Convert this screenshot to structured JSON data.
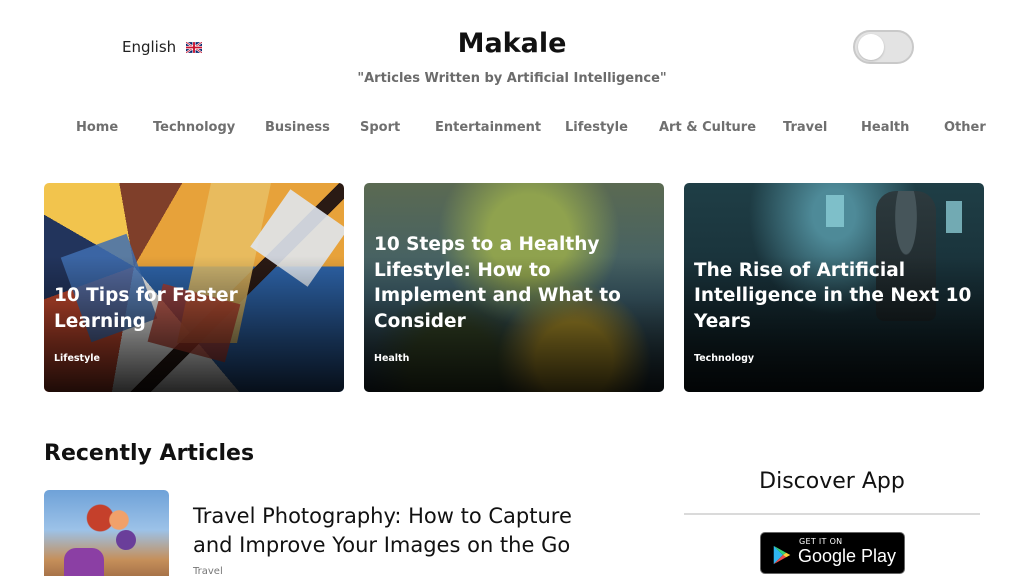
{
  "header": {
    "language": "English",
    "language_flag_icon": "uk-flag-icon",
    "brand": "Makale",
    "tagline": "\"Articles Written by Artificial Intelligence\"",
    "theme_toggle_state": "off"
  },
  "nav": {
    "items": [
      {
        "label": "Home"
      },
      {
        "label": "Technology"
      },
      {
        "label": "Business"
      },
      {
        "label": "Sport"
      },
      {
        "label": "Entertainment"
      },
      {
        "label": "Lifestyle"
      },
      {
        "label": "Art & Culture"
      },
      {
        "label": "Travel"
      },
      {
        "label": "Health"
      },
      {
        "label": "Other"
      }
    ]
  },
  "featured": [
    {
      "title": "10 Tips for Faster Learning",
      "category": "Lifestyle"
    },
    {
      "title": "10 Steps to a Healthy Lifestyle: How to Implement and What to Consider",
      "category": "Health"
    },
    {
      "title": "The Rise of Artificial Intelligence in the Next 10 Years",
      "category": "Technology"
    }
  ],
  "recent": {
    "heading": "Recently Articles",
    "articles": [
      {
        "title": "Travel Photography: How to Capture and Improve Your Images on the Go",
        "category": "Travel"
      }
    ]
  },
  "sidebar": {
    "heading": "Discover App",
    "google_play": {
      "small": "GET IT ON",
      "big": "Google Play"
    }
  },
  "colors": {
    "nav_text": "#6f6f6f",
    "tagline_text": "#6b6b6b",
    "toggle_bg": "#e3e3e3",
    "card_text": "#ffffff"
  }
}
